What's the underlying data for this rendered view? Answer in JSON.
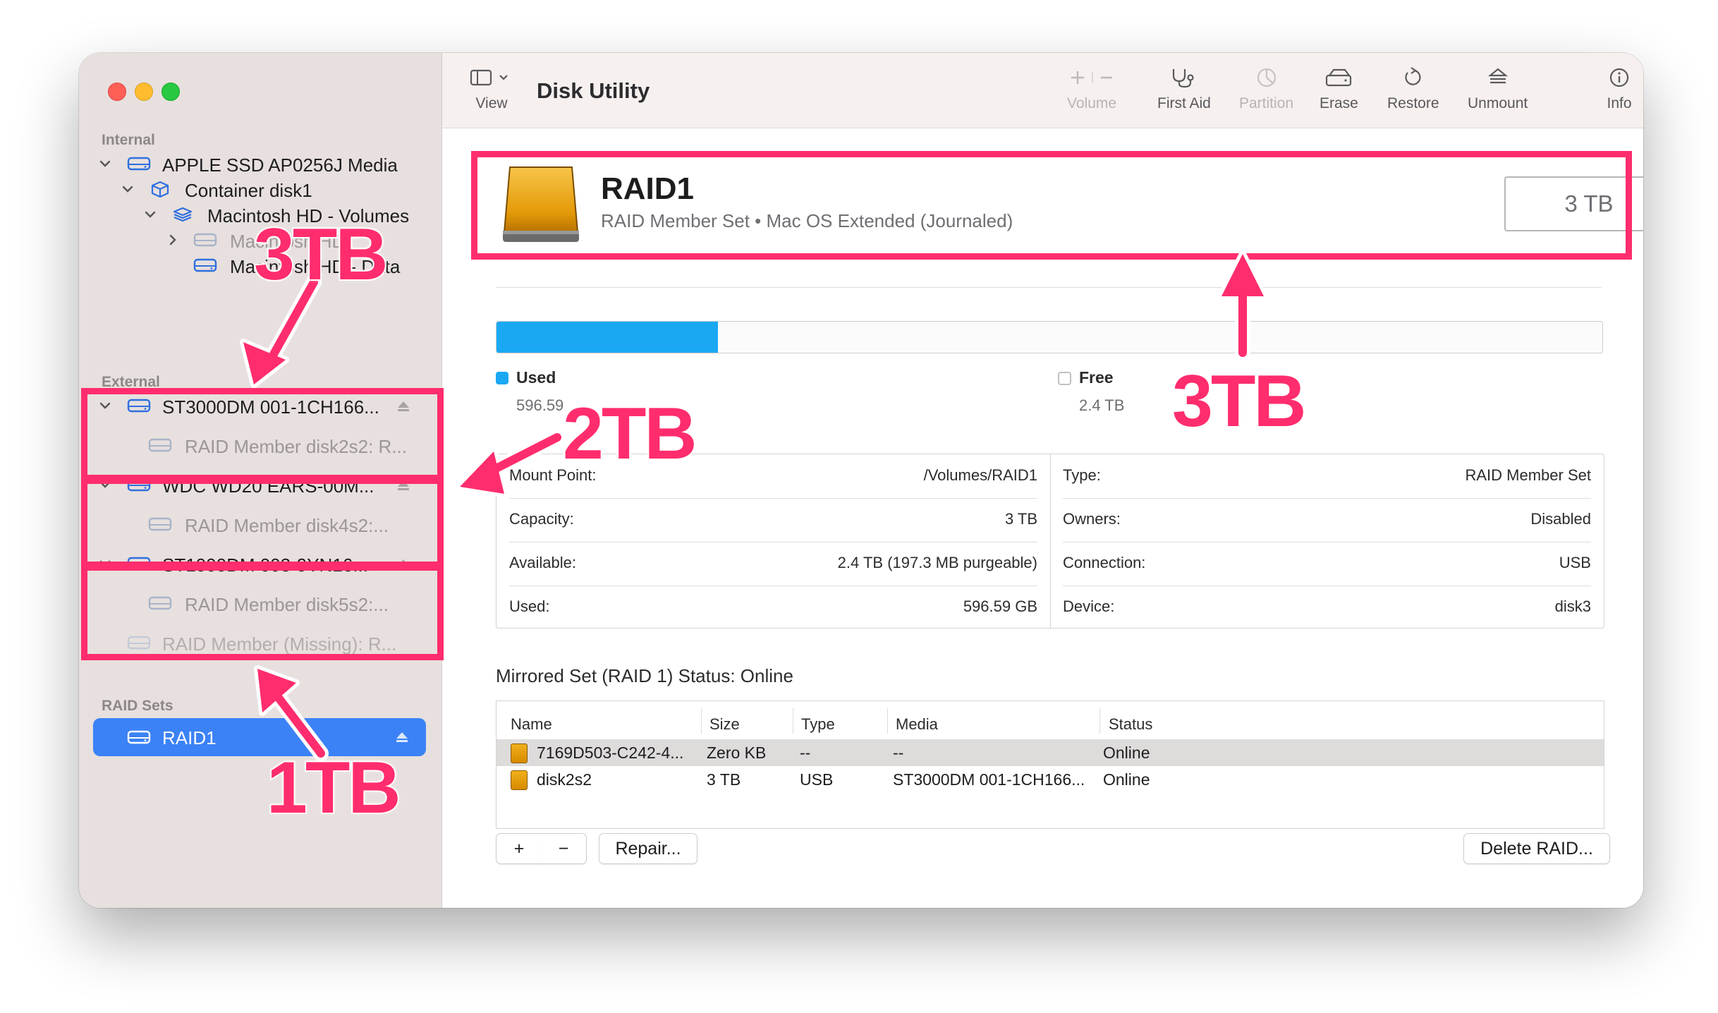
{
  "window": {
    "app_title": "Disk Utility"
  },
  "toolbar": {
    "view_label": "View",
    "volume_label": "Volume",
    "first_aid_label": "First Aid",
    "partition_label": "Partition",
    "erase_label": "Erase",
    "restore_label": "Restore",
    "unmount_label": "Unmount",
    "info_label": "Info"
  },
  "sidebar": {
    "internal_header": "Internal",
    "external_header": "External",
    "raid_header": "RAID Sets",
    "items": [
      {
        "label": "APPLE SSD AP0256J Media"
      },
      {
        "label": "Container disk1"
      },
      {
        "label": "Macintosh HD - Volumes"
      },
      {
        "label": "Macintosh HD"
      },
      {
        "label": "Macintosh HD - Data"
      },
      {
        "label": "ST3000DM 001-1CH166..."
      },
      {
        "label": "RAID Member disk2s2: R..."
      },
      {
        "label": "WDC WD20 EARS-00M..."
      },
      {
        "label": "RAID Member disk4s2:..."
      },
      {
        "label": "ST1000DM 003-9YN16..."
      },
      {
        "label": "RAID Member disk5s2:..."
      },
      {
        "label": "RAID Member (Missing): R..."
      },
      {
        "label": "RAID1"
      }
    ]
  },
  "header": {
    "name": "RAID1",
    "subtitle": "RAID Member Set • Mac OS Extended (Journaled)",
    "size": "3 TB",
    "used_fraction": 0.2
  },
  "usage": {
    "used_title": "Used",
    "used_value": "596.59",
    "free_title": "Free",
    "free_value": "2.4 TB",
    "used_color": "#1aa8f3"
  },
  "info": {
    "left": [
      {
        "key": "Mount Point:",
        "value": "/Volumes/RAID1"
      },
      {
        "key": "Capacity:",
        "value": "3 TB"
      },
      {
        "key": "Available:",
        "value": "2.4 TB (197.3 MB purgeable)"
      },
      {
        "key": "Used:",
        "value": "596.59 GB"
      }
    ],
    "right": [
      {
        "key": "Type:",
        "value": "RAID Member Set"
      },
      {
        "key": "Owners:",
        "value": "Disabled"
      },
      {
        "key": "Connection:",
        "value": "USB"
      },
      {
        "key": "Device:",
        "value": "disk3"
      }
    ]
  },
  "raid": {
    "status_title": "Mirrored Set (RAID 1) Status: Online",
    "columns": [
      "Name",
      "Size",
      "Type",
      "Media",
      "Status"
    ],
    "rows": [
      {
        "name": "7169D503-C242-4...",
        "size": "Zero KB",
        "type": "--",
        "media": "--",
        "status": "Online"
      },
      {
        "name": "disk2s2",
        "size": "3 TB",
        "type": "USB",
        "media": "ST3000DM 001-1CH166...",
        "status": "Online"
      }
    ],
    "add": "+",
    "remove": "−",
    "repair": "Repair...",
    "delete": "Delete RAID..."
  },
  "annotations": {
    "label_3tb_sidebar": "3TB",
    "label_2tb": "2TB",
    "label_1tb": "1TB",
    "label_3tb_header": "3TB",
    "accent": "#ff2d6d"
  }
}
